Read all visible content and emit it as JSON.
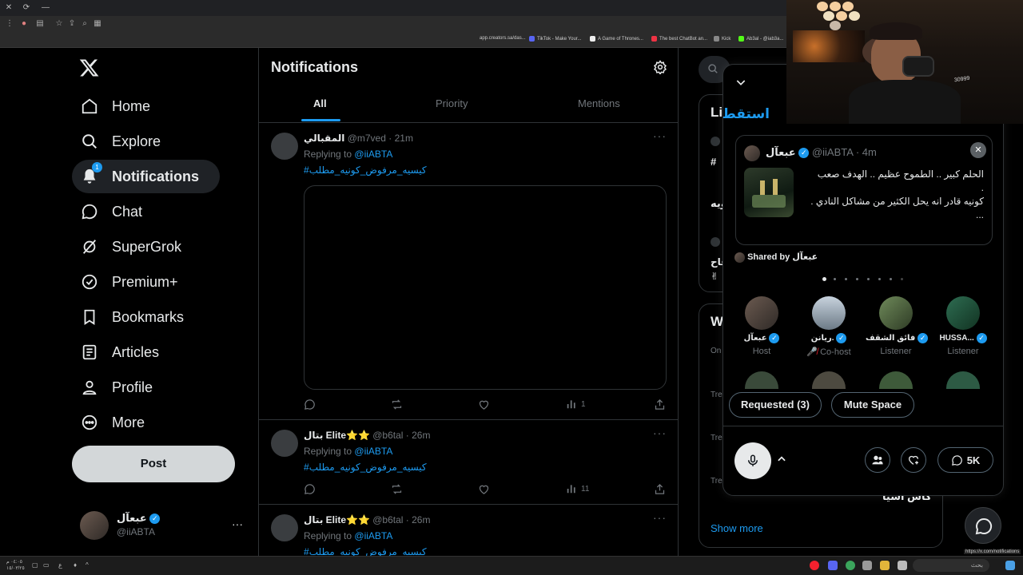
{
  "browser": {
    "bookmarks": [
      "app.creators.sa/das...",
      "TikTok - Make Your...",
      "A Game of Thrones...",
      "The best ChatBot an...",
      "Kick",
      "Ab3al - @iab3a..."
    ],
    "status_url": "https://x.com/notifications"
  },
  "nav": {
    "items": [
      {
        "label": "Home",
        "icon": "home-icon"
      },
      {
        "label": "Explore",
        "icon": "search-icon"
      },
      {
        "label": "Notifications",
        "icon": "bell-icon",
        "badge": "1",
        "active": true
      },
      {
        "label": "Chat",
        "icon": "chat-bubble-icon"
      },
      {
        "label": "SuperGrok",
        "icon": "grok-icon"
      },
      {
        "label": "Premium+",
        "icon": "verified-badge-icon"
      },
      {
        "label": "Bookmarks",
        "icon": "bookmark-icon"
      },
      {
        "label": "Articles",
        "icon": "article-icon"
      },
      {
        "label": "Profile",
        "icon": "person-icon"
      },
      {
        "label": "More",
        "icon": "more-circle-icon"
      }
    ],
    "post_label": "Post",
    "account": {
      "name": "عبعآل",
      "handle": "@iiABTA"
    }
  },
  "main": {
    "title": "Notifications",
    "tabs": [
      "All",
      "Priority",
      "Mentions"
    ],
    "notifications": [
      {
        "name": "المقبالي",
        "handle": "@m7ved",
        "time": "21m",
        "replying_prefix": "Replying to",
        "replying_to": "@iiABTA",
        "hashtag": "#كيسيه_مرفوض_كونيه_مطلب",
        "views": "1"
      },
      {
        "name": "بتال Elite⭐⭐",
        "handle": "@b6tal",
        "time": "26m",
        "replying_prefix": "Replying to",
        "replying_to": "@iiABTA",
        "hashtag": "#كيسيه_مرفوض_كونيه_مطلب",
        "views": "11"
      },
      {
        "name": "بتال Elite⭐⭐",
        "handle": "@b6tal",
        "time": "26m",
        "replying_prefix": "Replying to",
        "replying_to": "@iiABTA",
        "hashtag": "#كيسيه_مرفوض_كونيه_مطلب"
      }
    ]
  },
  "right": {
    "panel1_heading": "Li",
    "panel2_heading": "W",
    "trend_snippets": [
      "On",
      "Tre",
      "Tre",
      "Tre"
    ],
    "trend_text": "كاس اسيا",
    "show_more": "Show more",
    "side_snippets": [
      "#",
      "ويه",
      "فاح",
      "✌"
    ]
  },
  "space": {
    "title": "استقطاب",
    "shared_post": {
      "name": "عبعآل",
      "handle": "@iiABTA",
      "time": "4m",
      "line1": "الحلم كبير .. الطموح عظيم .. الهدف صعب",
      "line2": ".",
      "line3": "كونيه قادر انه يحل الكثير من مشاكل النادي .",
      "more": "..."
    },
    "shared_by_prefix": "Shared by",
    "shared_by_name": "عبعآل",
    "speakers": [
      {
        "name": "عبعآل",
        "role": "Host"
      },
      {
        "name": "ريانن.",
        "role": "Co-host",
        "muted": true
      },
      {
        "name": "فائق الشقف",
        "role": "Listener"
      },
      {
        "name": "HUSSA...",
        "role": "Listener"
      }
    ],
    "requested_label": "Requested (3)",
    "mute_label": "Mute Space",
    "listeners_count": "5K"
  },
  "webcam": {
    "overlay_text": "30999"
  },
  "taskbar": {
    "clock_time": "٠٤:٠٥ م",
    "clock_date": "١٥/٠٣/٢٥",
    "lang": "ع",
    "search_placeholder": "بحث"
  }
}
